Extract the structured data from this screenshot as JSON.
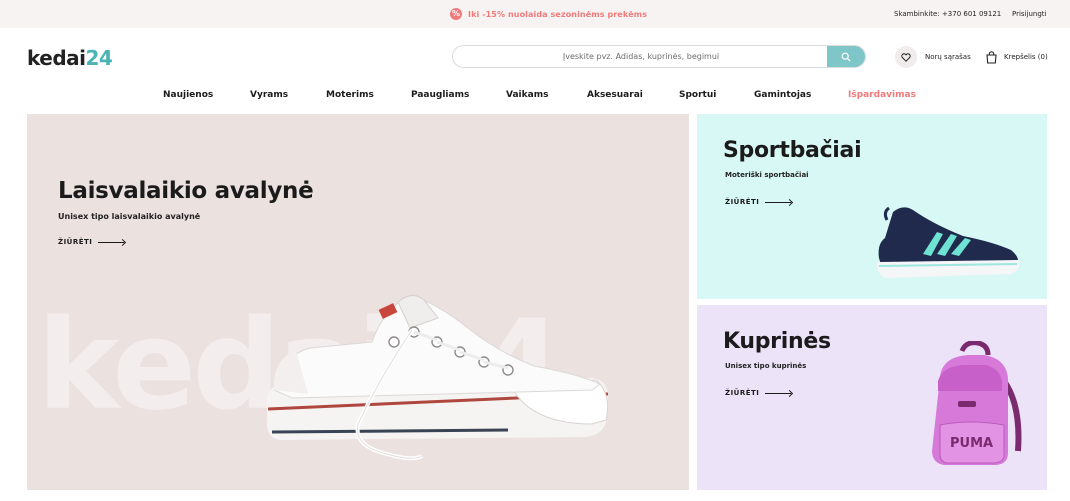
{
  "topbar": {
    "promo_icon": "%",
    "promo_text": "Iki -15% nuolaida sezoninėms prekėms",
    "phone": "Skambinkite: +370 601 09121",
    "login": "Prisijungti"
  },
  "header": {
    "logo_word": "kedai",
    "logo_number": "24",
    "search_placeholder": "Įveskite pvz. Adidas, kuprinės, begimui",
    "wishlist_label": "Norų sąrašas",
    "cart_label": "Krepšelis (0)"
  },
  "nav": {
    "items": [
      {
        "label": "Naujienos"
      },
      {
        "label": "Vyrams"
      },
      {
        "label": "Moterims"
      },
      {
        "label": "Paaugliams"
      },
      {
        "label": "Vaikams"
      },
      {
        "label": "Aksesuarai"
      },
      {
        "label": "Sportui"
      },
      {
        "label": "Gamintojas"
      },
      {
        "label": "Išpardavimas"
      }
    ]
  },
  "hero": {
    "watermark": "kedai24",
    "title": "Laisvalaikio avalynė",
    "subtitle": "Unisex tipo laisvalaikio avalynė",
    "cta": "ŽIŪRĖTI"
  },
  "cards": {
    "sport": {
      "title": "Sportbačiai",
      "subtitle": "Moteriški sportbačiai",
      "cta": "ŽIŪRĖTI"
    },
    "bag": {
      "title": "Kuprinės",
      "subtitle": "Unisex tipo kuprinės",
      "cta": "ŽIŪRĖTI",
      "brand_print": "PUMA"
    }
  },
  "colors": {
    "accent_teal": "#7ec6c7",
    "sale_red": "#f07a7a",
    "hero_bg": "#ebe1df",
    "sport_bg": "#d8f8f6",
    "bag_bg": "#ece3f9"
  }
}
